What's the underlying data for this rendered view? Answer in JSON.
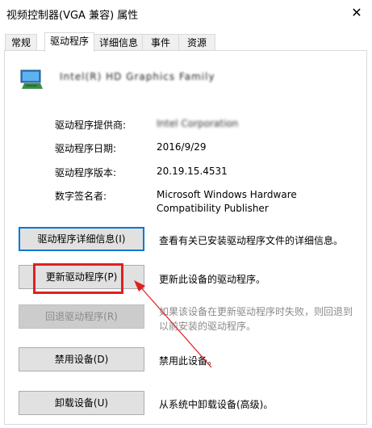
{
  "window": {
    "title": "视频控制器(VGA 兼容) 属性",
    "close_icon": "close-icon"
  },
  "tabs": [
    {
      "label": "常规"
    },
    {
      "label": "驱动程序",
      "active": true
    },
    {
      "label": "详细信息"
    },
    {
      "label": "事件"
    },
    {
      "label": "资源"
    }
  ],
  "device": {
    "icon": "display-adapter-icon",
    "name": "Intel(R) HD Graphics Family"
  },
  "info": {
    "provider_label": "驱动程序提供商:",
    "provider_value": "Intel Corporation",
    "date_label": "驱动程序日期:",
    "date_value": "2016/9/29",
    "version_label": "驱动程序版本:",
    "version_value": "20.19.15.4531",
    "signer_label": "数字签名者:",
    "signer_value_line1": "Microsoft Windows Hardware",
    "signer_value_line2": "Compatibility Publisher"
  },
  "actions": {
    "details_button": "驱动程序详细信息(I)",
    "details_desc": "查看有关已安装驱动程序文件的详细信息。",
    "update_button": "更新驱动程序(P)",
    "update_desc": "更新此设备的驱动程序。",
    "rollback_button": "回退驱动程序(R)",
    "rollback_desc_line1": "如果该设备在更新驱动程序时失败，则回退到",
    "rollback_desc_line2": "以前安装的驱动程序。",
    "disable_button": "禁用设备(D)",
    "disable_desc": "禁用此设备。",
    "uninstall_button": "卸载设备(U)",
    "uninstall_desc": "从系统中卸载设备(高级)。"
  },
  "annotation": {
    "highlight_color": "#e02020"
  }
}
